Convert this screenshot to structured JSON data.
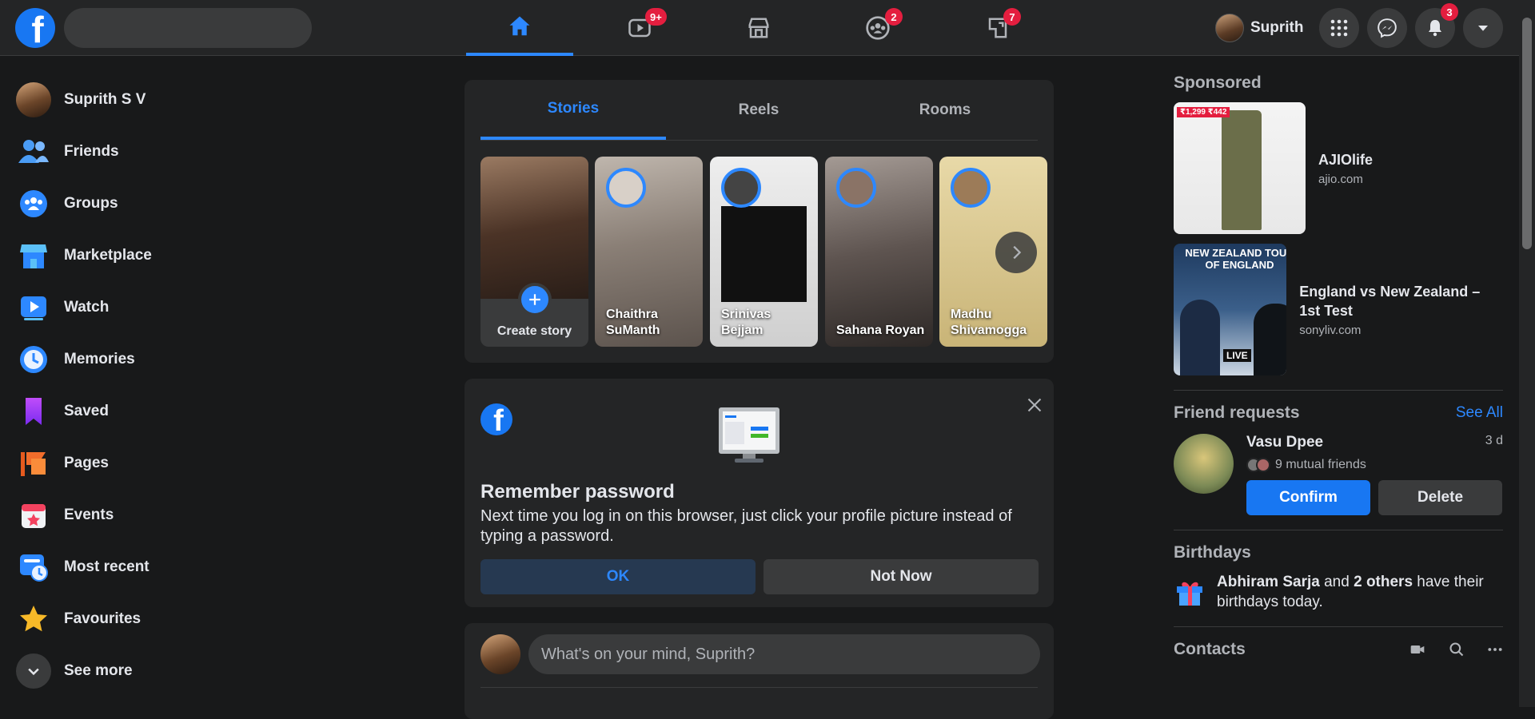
{
  "topbar": {
    "logo": "f",
    "search_placeholder": "",
    "nav": [
      {
        "name": "home",
        "icon": "home-icon",
        "badge": ""
      },
      {
        "name": "watch",
        "icon": "video-icon",
        "badge": "9+"
      },
      {
        "name": "marketplace",
        "icon": "store-icon",
        "badge": ""
      },
      {
        "name": "groups",
        "icon": "groups-icon",
        "badge": "2"
      },
      {
        "name": "gaming",
        "icon": "gaming-icon",
        "badge": "7"
      }
    ],
    "profile_name": "Suprith",
    "notifications_badge": "3"
  },
  "leftnav": {
    "items": [
      {
        "label": "Suprith S V",
        "icon": "avatar"
      },
      {
        "label": "Friends",
        "icon": "friends-icon"
      },
      {
        "label": "Groups",
        "icon": "groups-icon"
      },
      {
        "label": "Marketplace",
        "icon": "marketplace-icon"
      },
      {
        "label": "Watch",
        "icon": "watch-icon"
      },
      {
        "label": "Memories",
        "icon": "memories-icon"
      },
      {
        "label": "Saved",
        "icon": "saved-icon"
      },
      {
        "label": "Pages",
        "icon": "pages-icon"
      },
      {
        "label": "Events",
        "icon": "events-icon"
      },
      {
        "label": "Most recent",
        "icon": "most-recent-icon"
      },
      {
        "label": "Favourites",
        "icon": "star-icon"
      },
      {
        "label": "See more",
        "icon": "chevron-down-icon"
      }
    ]
  },
  "stories": {
    "tabs": [
      "Stories",
      "Reels",
      "Rooms"
    ],
    "create_label": "Create story",
    "items": [
      {
        "name_line1": "Chaithra",
        "name_line2": "SuManth"
      },
      {
        "name_line1": "Srinivas",
        "name_line2": "Bejjam"
      },
      {
        "name_line1": "Sahana Royan",
        "name_line2": ""
      },
      {
        "name_line1": "Madhu",
        "name_line2": "Shivamogga"
      }
    ]
  },
  "remember_password": {
    "title": "Remember password",
    "text": "Next time you log in on this browser, just click your profile picture instead of typing a password.",
    "ok_label": "OK",
    "not_now_label": "Not Now"
  },
  "composer": {
    "placeholder": "What's on your mind, Suprith?"
  },
  "right": {
    "sponsored_title": "Sponsored",
    "ads": [
      {
        "title": "AJIOlife",
        "domain": "ajio.com",
        "price_tag": "₹1,299 ₹442"
      },
      {
        "title": "England vs New Zealand – 1st Test",
        "domain": "sonyliv.com",
        "banner_line1": "NEW ZEALAND TOUR",
        "banner_line2": "OF ENGLAND",
        "banner_live": "LIVE"
      }
    ],
    "friend_requests": {
      "title": "Friend requests",
      "see_all": "See All",
      "name": "Vasu Dpee",
      "time": "3 d",
      "mutual": "9 mutual friends",
      "confirm": "Confirm",
      "delete": "Delete"
    },
    "birthdays": {
      "title": "Birthdays",
      "name": "Abhiram Sarja",
      "and_text": "and",
      "others": "2 others",
      "suffix": "have their birthdays today."
    },
    "contacts_title": "Contacts"
  }
}
